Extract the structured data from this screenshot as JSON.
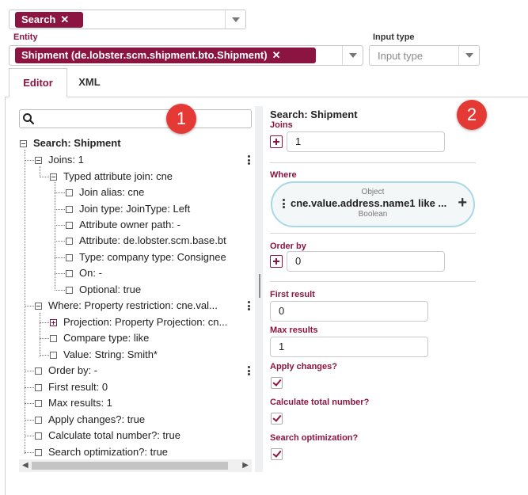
{
  "top_search": {
    "chip_label": "Search",
    "chip_remove": "✕"
  },
  "entity": {
    "label": "Entity",
    "chip_label": "Shipment (de.lobster.scm.shipment.bto.Shipment)",
    "chip_remove": "✕"
  },
  "input_type": {
    "label": "Input type",
    "placeholder": "Input type"
  },
  "tabs": [
    {
      "label": "Editor"
    },
    {
      "label": "XML"
    }
  ],
  "tree": {
    "root": "Search: Shipment",
    "joins": "Joins: 1",
    "typed_join": "Typed attribute join: cne",
    "join_alias": "Join alias: cne",
    "join_type": "Join type: JoinType: Left",
    "attr_owner_path": "Attribute owner path: -",
    "attribute": "Attribute: de.lobster.scm.base.bt",
    "type": "Type: company type: Consignee",
    "on": "On: -",
    "optional": "Optional: true",
    "where": "Where: Property restriction: cne.val...",
    "projection": "Projection: Property Projection: cn...",
    "compare_type": "Compare type: like",
    "value": "Value: String: Smith*",
    "order_by": "Order by: -",
    "first_result": "First result: 0",
    "max_results": "Max results: 1",
    "apply_changes": "Apply changes?: true",
    "calc_total": "Calculate total number?: true",
    "search_opt": "Search optimization?: true"
  },
  "detail": {
    "title": "Search: Shipment",
    "joins_label": "Joins",
    "joins_value": "1",
    "where_label": "Where",
    "where_object": "Object",
    "where_expr": "cne.value.address.name1 like ...",
    "where_type": "Boolean",
    "order_by_label": "Order by",
    "order_by_value": "0",
    "first_result_label": "First result",
    "first_result_value": "0",
    "max_results_label": "Max results",
    "max_results_value": "1",
    "apply_changes_label": "Apply changes?",
    "calc_total_label": "Calculate total number?",
    "search_opt_label": "Search optimization?"
  },
  "badges": {
    "one": "1",
    "two": "2"
  },
  "colors": {
    "accent": "#8b1540",
    "badge": "#e53935",
    "pill_border": "#a8d8e8"
  },
  "icons": {
    "search": "search-icon",
    "caret": "chevron-down-icon",
    "kebab": "kebab-menu-icon"
  }
}
